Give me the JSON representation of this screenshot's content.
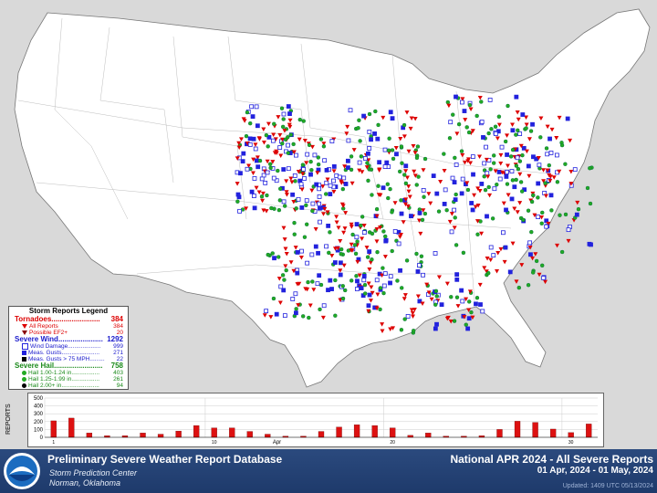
{
  "legend": {
    "title": "Storm Reports Legend",
    "tornado_label": "Tornadoes........................",
    "tornado_total": "384",
    "tornado_all_label": "All Reports",
    "tornado_all_value": "384",
    "tornado_ef2_label": "Possible EF2+",
    "tornado_ef2_value": "20",
    "wind_label": "Severe Wind......................",
    "wind_total": "1292",
    "wind_damage_label": "Wind Damage....................",
    "wind_damage_value": "999",
    "wind_meas_label": "Meas. Gusts.......................",
    "wind_meas_value": "271",
    "wind_75_label": "Meas. Gusts > 75 MPH.........",
    "wind_75_value": "22",
    "hail_label": "Severe Hail........................",
    "hail_total": "758",
    "hail_1_label": "Hail 1.00-1.24 in.................",
    "hail_1_value": "403",
    "hail_2_label": "Hail 1.25-1.99 in.................",
    "hail_2_value": "261",
    "hail_3_label": "Hail 2.00+ in.......................",
    "hail_3_value": "94"
  },
  "histogram": {
    "ylabel": "REPORTS",
    "month_label": "Apr",
    "chart_data": {
      "type": "bar",
      "x": [
        1,
        2,
        3,
        4,
        5,
        6,
        7,
        8,
        9,
        10,
        11,
        12,
        13,
        14,
        15,
        16,
        17,
        18,
        19,
        20,
        21,
        22,
        23,
        24,
        25,
        26,
        27,
        28,
        29,
        30
      ],
      "values": [
        210,
        245,
        55,
        20,
        20,
        55,
        40,
        80,
        150,
        120,
        120,
        75,
        40,
        15,
        15,
        75,
        130,
        160,
        150,
        120,
        25,
        55,
        15,
        15,
        20,
        100,
        205,
        190,
        105,
        60
      ],
      "extra_last": 170,
      "ylim": [
        0,
        500
      ],
      "yticks": [
        "0",
        "100",
        "200",
        "300",
        "400",
        "500"
      ],
      "xticks": [
        "1",
        "10",
        "20",
        "30"
      ]
    }
  },
  "colors": {
    "tornado": "#dd0000",
    "wind": "#2222dd",
    "hail": "#22aa22",
    "header": "#1e3a6b"
  },
  "footer": {
    "title": "Preliminary Severe Weather Report Database",
    "sub1": "Storm Prediction Center",
    "sub2": "Norman, Oklahoma",
    "right_title": "National APR 2024 - All Severe Reports",
    "range": "01 Apr, 2024 - 01 May, 2024",
    "updated": "Updated: 1409 UTC 05/13/2024",
    "logo": "noaa-logo"
  }
}
